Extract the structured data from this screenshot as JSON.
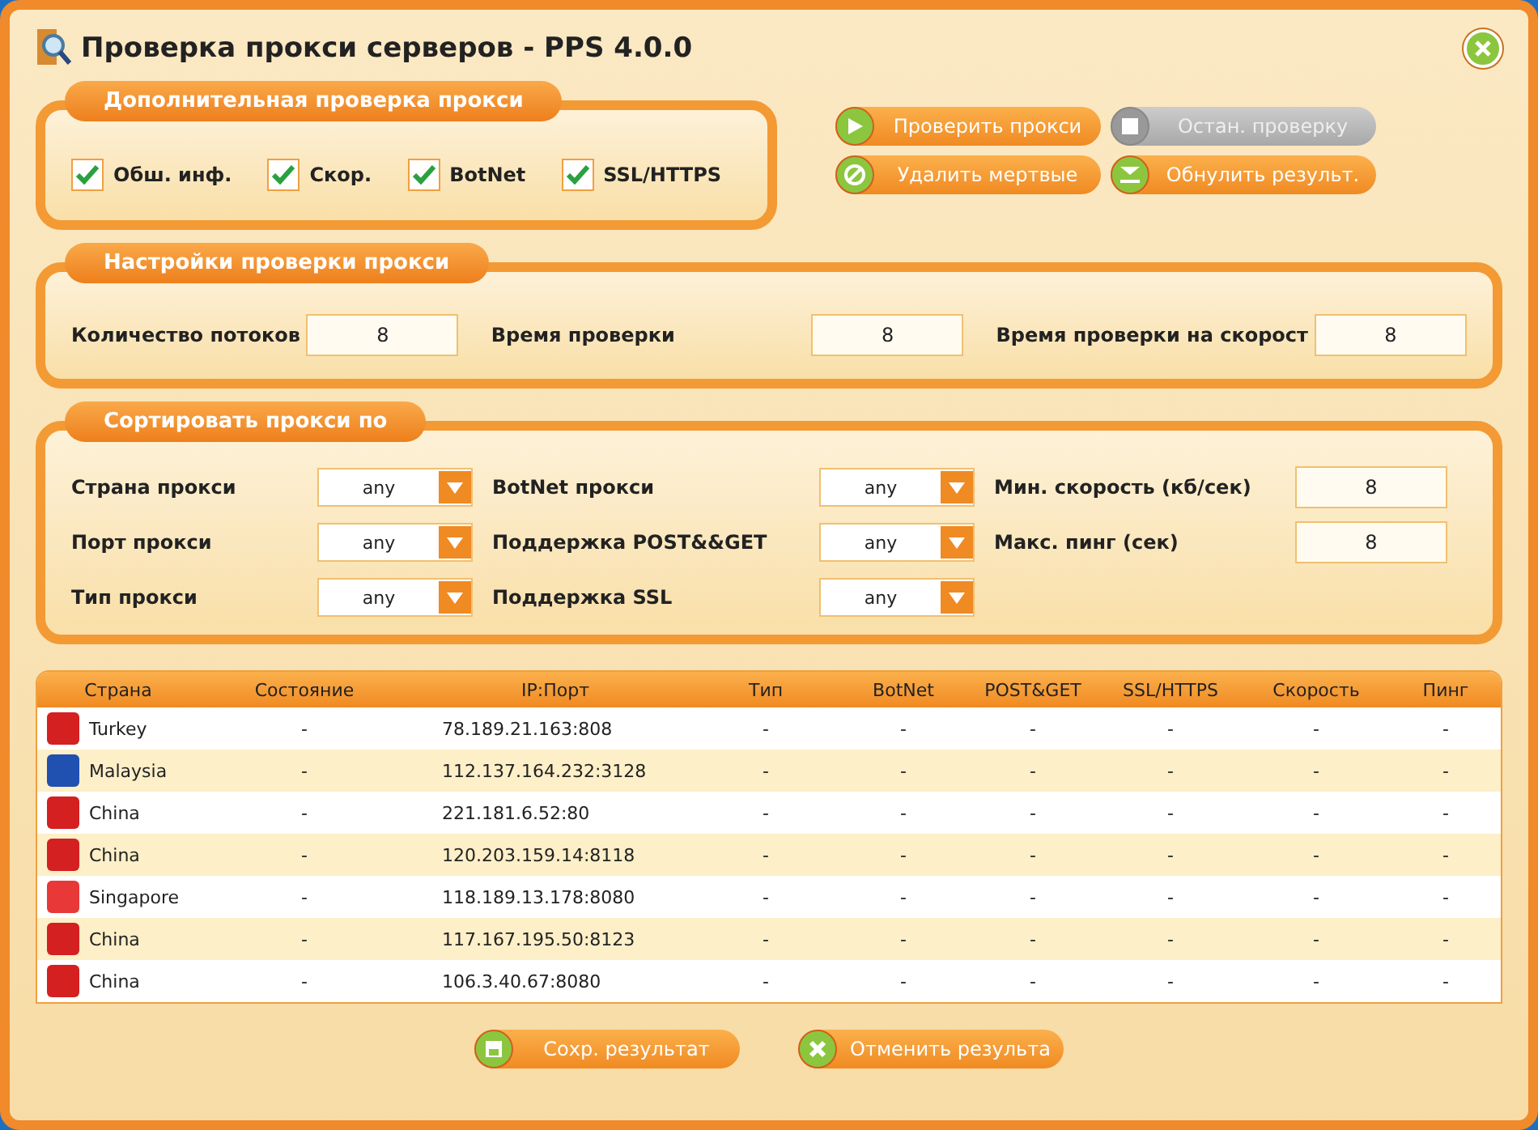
{
  "window": {
    "title": "Проверка прокси серверов - PPS 4.0.0"
  },
  "extra_check": {
    "title": "Дополнительная проверка прокси",
    "options": [
      {
        "label": "Обш. инф.",
        "checked": true
      },
      {
        "label": "Скор.",
        "checked": true
      },
      {
        "label": "BotNet",
        "checked": true
      },
      {
        "label": "SSL/HTTPS",
        "checked": true
      }
    ]
  },
  "actions": [
    {
      "label": "Проверить прокси",
      "kind": "play",
      "disabled": false
    },
    {
      "label": "Остан. проверку",
      "kind": "stop",
      "disabled": true
    },
    {
      "label": "Удалить мертвые",
      "kind": "ban",
      "disabled": false
    },
    {
      "label": "Обнулить результ.",
      "kind": "reset",
      "disabled": false
    }
  ],
  "settings": {
    "title": "Настройки проверки прокси",
    "fields": [
      {
        "label": "Количество потоков",
        "value": "8"
      },
      {
        "label": "Время проверки",
        "value": "8"
      },
      {
        "label": "Время проверки на скорост",
        "value": "8"
      }
    ]
  },
  "sort": {
    "title": "Сортировать прокси по",
    "columns": [
      [
        {
          "label": "Страна прокси",
          "kind": "select",
          "value": "any"
        },
        {
          "label": "Порт прокси",
          "kind": "select",
          "value": "any"
        },
        {
          "label": "Тип прокси",
          "kind": "select",
          "value": "any"
        }
      ],
      [
        {
          "label": "BotNet прокси",
          "kind": "select",
          "value": "any"
        },
        {
          "label": "Поддержка POST&&GET",
          "kind": "select",
          "value": "any"
        },
        {
          "label": "Поддержка SSL",
          "kind": "select",
          "value": "any"
        }
      ],
      [
        {
          "label": "Мин. скорость (кб/сек)",
          "kind": "input",
          "value": "8"
        },
        {
          "label": "Макс. пинг (сек)",
          "kind": "input",
          "value": "8"
        }
      ]
    ]
  },
  "table": {
    "columns": [
      "Страна",
      "Состояние",
      "IP:Порт",
      "Тип",
      "BotNet",
      "POST&GET",
      "SSL/HTTPS",
      "Скорость",
      "Пинг"
    ],
    "rows": [
      {
        "color": "#d42020",
        "cells": [
          "Turkey",
          "-",
          "78.189.21.163:808",
          "-",
          "-",
          "-",
          "-",
          "-",
          "-"
        ]
      },
      {
        "color": "#2050b0",
        "cells": [
          "Malaysia",
          "-",
          "112.137.164.232:3128",
          "-",
          "-",
          "-",
          "-",
          "-",
          "-"
        ]
      },
      {
        "color": "#d42020",
        "cells": [
          "China",
          "-",
          "221.181.6.52:80",
          "-",
          "-",
          "-",
          "-",
          "-",
          "-"
        ]
      },
      {
        "color": "#d42020",
        "cells": [
          "China",
          "-",
          "120.203.159.14:8118",
          "-",
          "-",
          "-",
          "-",
          "-",
          "-"
        ]
      },
      {
        "color": "#e83838",
        "cells": [
          "Singapore",
          "-",
          "118.189.13.178:8080",
          "-",
          "-",
          "-",
          "-",
          "-",
          "-"
        ]
      },
      {
        "color": "#d42020",
        "cells": [
          "China",
          "-",
          "117.167.195.50:8123",
          "-",
          "-",
          "-",
          "-",
          "-",
          "-"
        ]
      },
      {
        "color": "#d42020",
        "cells": [
          "China",
          "-",
          "106.3.40.67:8080",
          "-",
          "-",
          "-",
          "-",
          "-",
          "-"
        ]
      }
    ]
  },
  "footer": [
    {
      "label": "Сохр. результат",
      "kind": "save",
      "disabled": false
    },
    {
      "label": "Отменить результа",
      "kind": "cancel",
      "disabled": false
    }
  ]
}
